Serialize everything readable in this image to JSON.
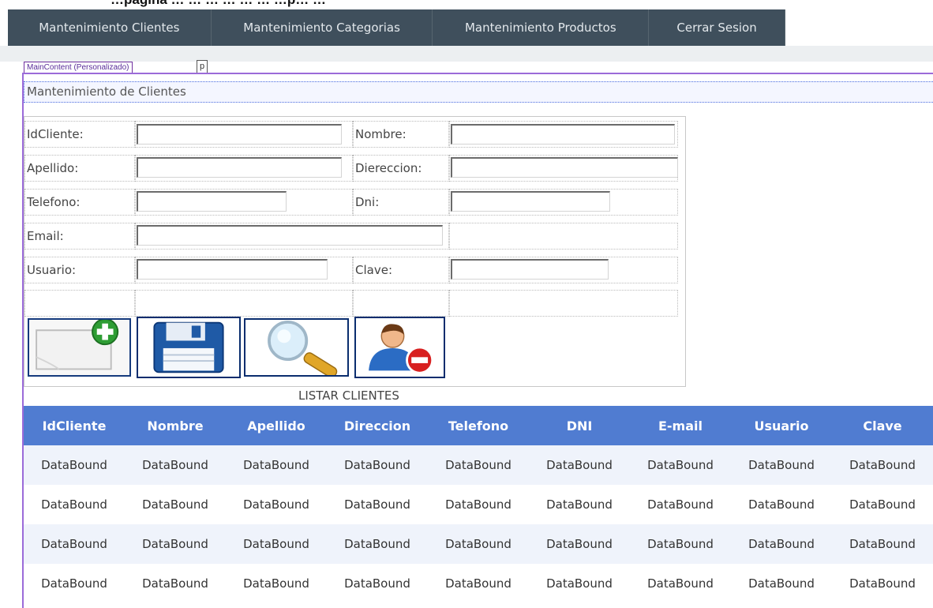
{
  "nav": {
    "items": [
      {
        "label": "Mantenimiento Clientes"
      },
      {
        "label": "Mantenimiento Categorias"
      },
      {
        "label": "Mantenimiento Productos"
      },
      {
        "label": "Cerrar Sesion"
      }
    ]
  },
  "header_cut_text": "…pagina … … … … … … …p… …",
  "designer": {
    "content_tag": "MainContent (Personalizado)",
    "p_tag": "p"
  },
  "page_title": "Mantenimiento de Clientes",
  "form": {
    "idcliente_label": "IdCliente:",
    "nombre_label": "Nombre:",
    "apellido_label": "Apellido:",
    "direccion_label": "Diereccion:",
    "telefono_label": "Telefono:",
    "dni_label": "Dni:",
    "email_label": "Email:",
    "usuario_label": "Usuario:",
    "clave_label": "Clave:"
  },
  "buttons": {
    "new_icon": "new-document-plus-icon",
    "save_icon": "floppy-disk-icon",
    "search_icon": "magnifier-icon",
    "delete_icon": "user-remove-icon"
  },
  "list_caption": "LISTAR CLIENTES",
  "grid": {
    "columns": [
      "IdCliente",
      "Nombre",
      "Apellido",
      "Direccion",
      "Telefono",
      "DNI",
      "E-mail",
      "Usuario",
      "Clave"
    ],
    "rows": [
      [
        "DataBound",
        "DataBound",
        "DataBound",
        "DataBound",
        "DataBound",
        "DataBound",
        "DataBound",
        "DataBound",
        "DataBound"
      ],
      [
        "DataBound",
        "DataBound",
        "DataBound",
        "DataBound",
        "DataBound",
        "DataBound",
        "DataBound",
        "DataBound",
        "DataBound"
      ],
      [
        "DataBound",
        "DataBound",
        "DataBound",
        "DataBound",
        "DataBound",
        "DataBound",
        "DataBound",
        "DataBound",
        "DataBound"
      ],
      [
        "DataBound",
        "DataBound",
        "DataBound",
        "DataBound",
        "DataBound",
        "DataBound",
        "DataBound",
        "DataBound",
        "DataBound"
      ]
    ]
  },
  "colors": {
    "navbar": "#3f4f5c",
    "grid_header": "#507cd1",
    "grid_alt_row": "#eff3fb",
    "content_border": "#9b6bd9"
  }
}
